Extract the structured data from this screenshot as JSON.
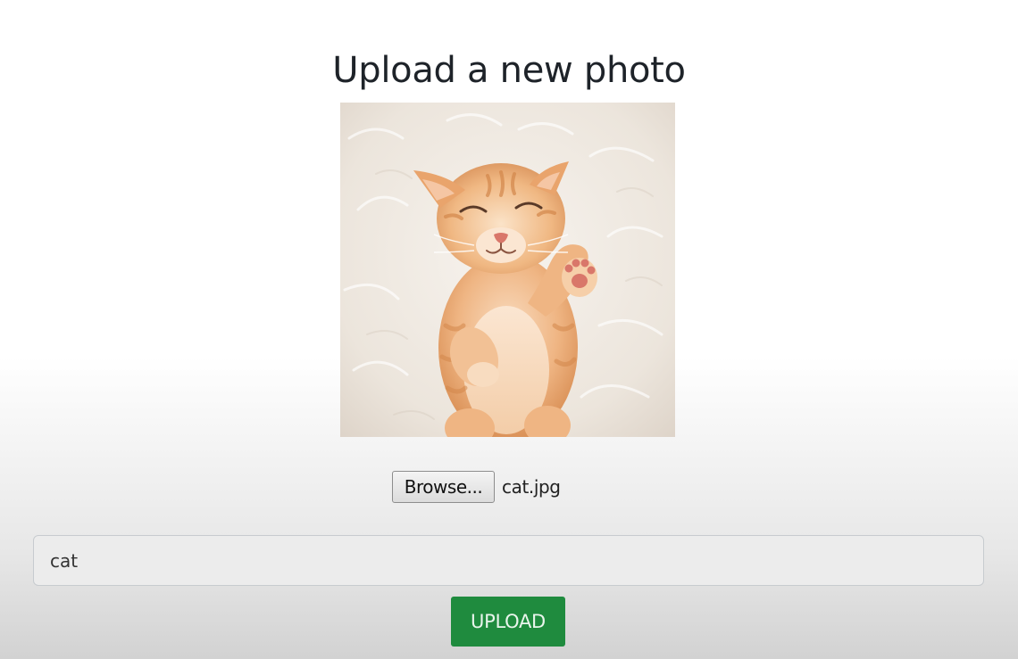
{
  "page": {
    "title": "Upload a new photo"
  },
  "preview": {
    "subject": "cat-photo",
    "colors": {
      "background_fur": "#efe9e2",
      "kitten": "#e8a870",
      "kitten_light": "#f6d2ae",
      "paw_pads": "#d9776a"
    }
  },
  "file_input": {
    "button_label": "Browse...",
    "selected_file": "cat.jpg"
  },
  "caption_input": {
    "value": "cat"
  },
  "upload_button": {
    "label": "UPLOAD",
    "color": "#1f8b3e"
  }
}
